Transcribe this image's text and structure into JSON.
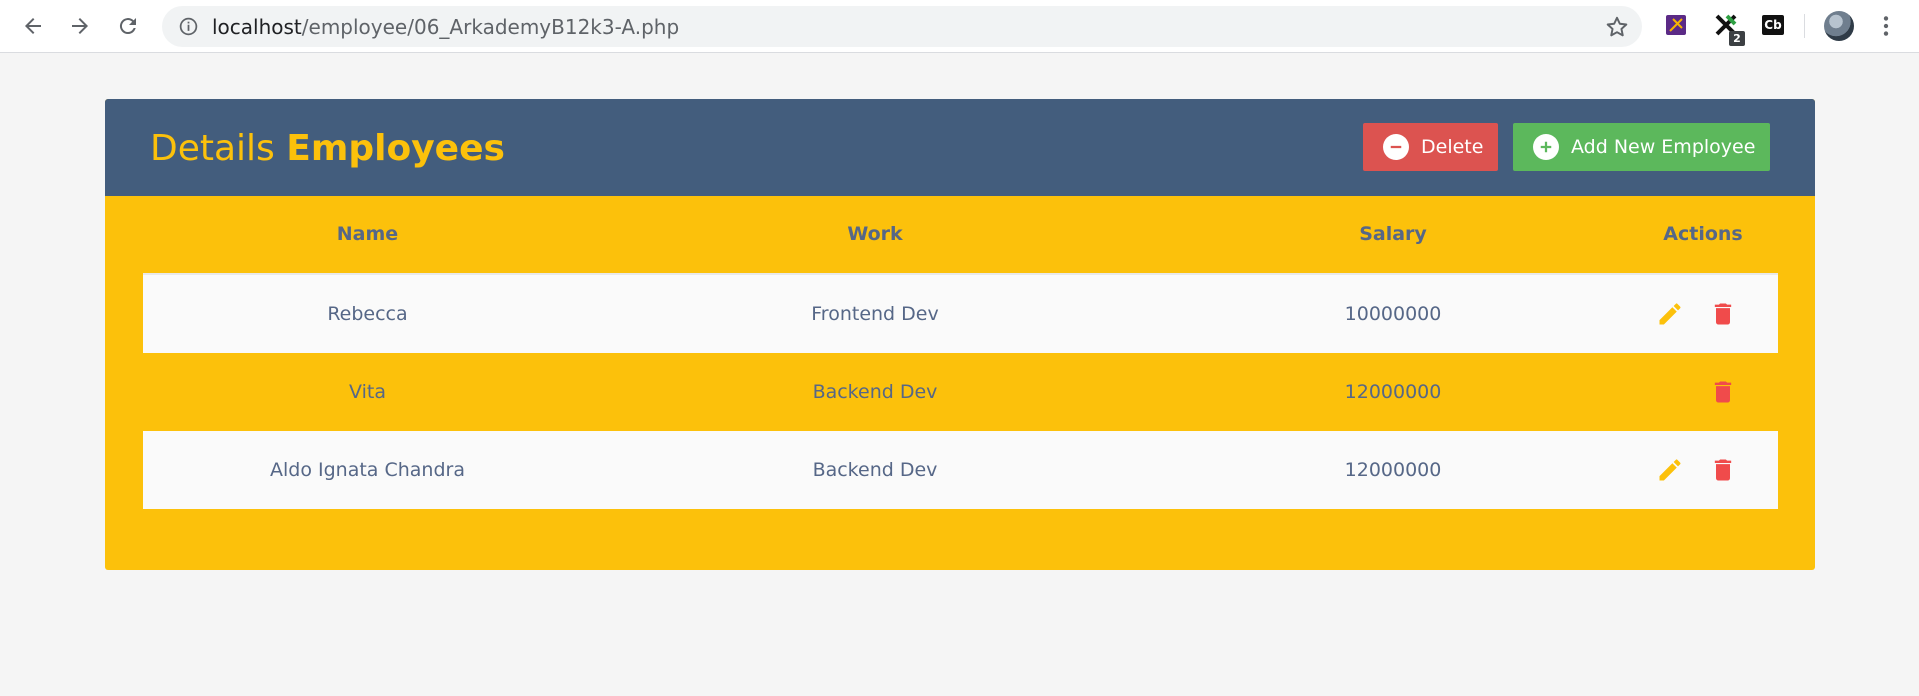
{
  "browser": {
    "url_host": "localhost",
    "url_path": "/employee/06_ArkademyB12k3-A.php",
    "extension_badge": "2",
    "extension_cb_label": "Cb"
  },
  "header": {
    "title_light": "Details",
    "title_bold": "Employees",
    "delete_label": "Delete",
    "add_label": "Add New Employee"
  },
  "table": {
    "columns": [
      "Name",
      "Work",
      "Salary",
      "Actions"
    ],
    "rows": [
      {
        "name": "Rebecca",
        "work": "Frontend Dev",
        "salary": "10000000",
        "editable": true
      },
      {
        "name": "Vita",
        "work": "Backend Dev",
        "salary": "12000000",
        "editable": false
      },
      {
        "name": "Aldo Ignata Chandra",
        "work": "Backend Dev",
        "salary": "12000000",
        "editable": true
      }
    ]
  },
  "colors": {
    "header_bg": "#435d7d",
    "accent_yellow": "#fcc10b",
    "delete_red": "#dc5350",
    "add_green": "#5cb85c",
    "text_slate": "#566787"
  },
  "icons": {
    "back": "arrow-left-icon",
    "forward": "arrow-right-icon",
    "reload": "reload-icon",
    "info": "info-icon",
    "bookmark": "star-icon",
    "menu": "kebab-menu-icon",
    "delete_btn": "minus-circle-icon",
    "add_btn": "plus-circle-icon",
    "edit": "pencil-icon",
    "trash": "trash-icon"
  }
}
